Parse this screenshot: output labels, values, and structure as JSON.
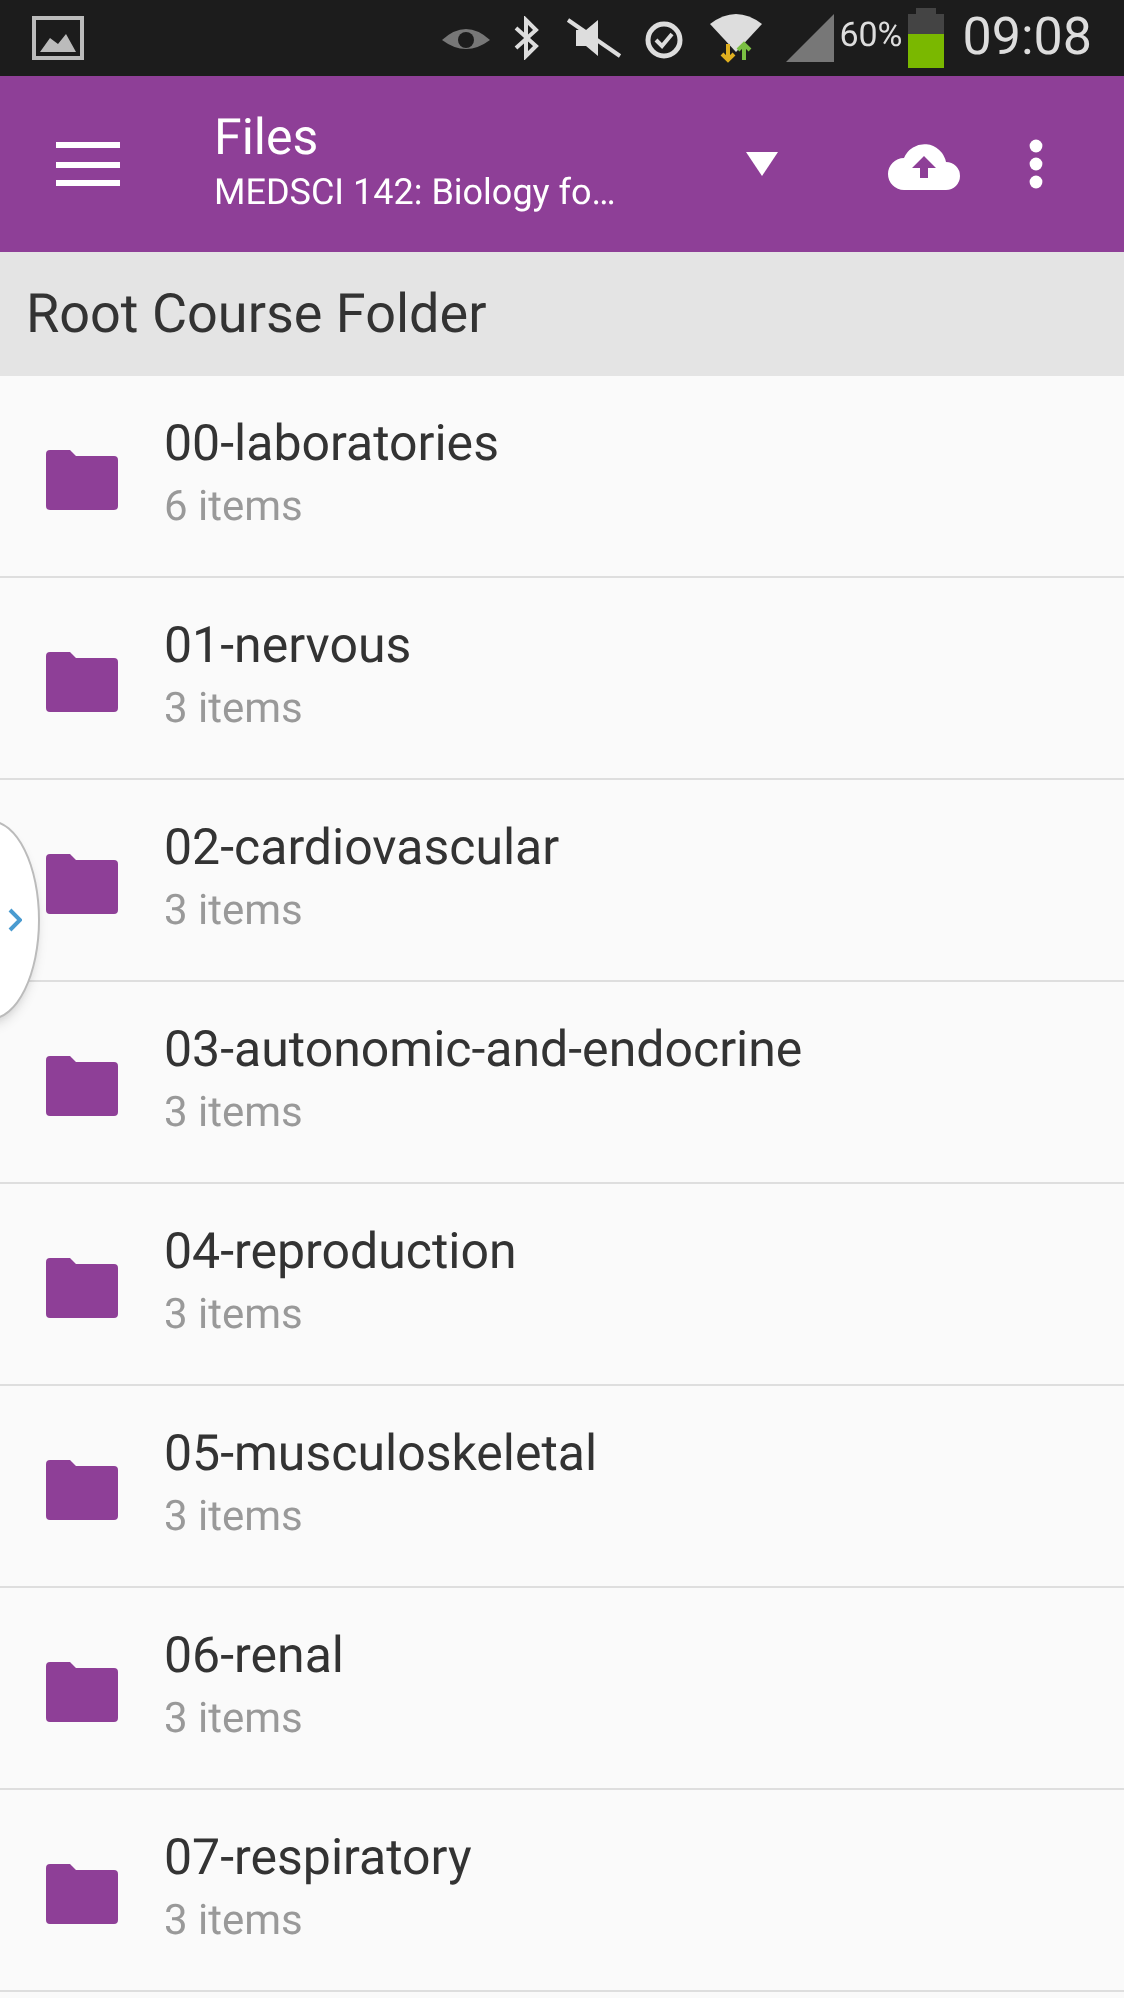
{
  "status_bar": {
    "battery": "60%",
    "time": "09:08"
  },
  "app_bar": {
    "title": "Files",
    "subtitle": "MEDSCI 142: Biology fo…"
  },
  "section_header": "Root Course Folder",
  "folders": [
    {
      "name": "00-laboratories",
      "count": "6 items"
    },
    {
      "name": "01-nervous",
      "count": "3 items"
    },
    {
      "name": "02-cardiovascular",
      "count": "3 items"
    },
    {
      "name": "03-autonomic-and-endocrine",
      "count": "3 items"
    },
    {
      "name": "04-reproduction",
      "count": "3 items"
    },
    {
      "name": "05-musculoskeletal",
      "count": "3 items"
    },
    {
      "name": "06-renal",
      "count": "3 items"
    },
    {
      "name": "07-respiratory",
      "count": "3 items"
    }
  ]
}
